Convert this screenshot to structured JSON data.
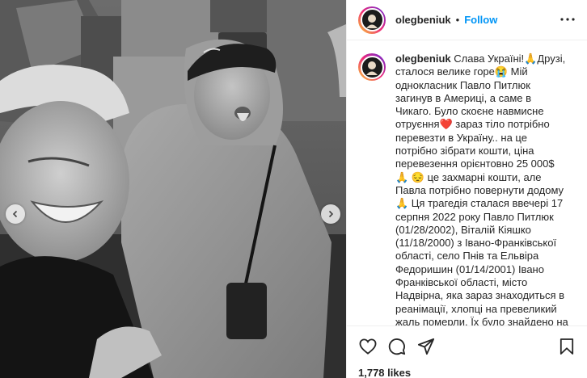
{
  "post": {
    "username": "olegbeniuk",
    "follow_label": "Follow",
    "separator": "•",
    "caption": "Слава Україні!🙏Друзі, сталося велике горе😭 Мій однокласник Павло Питлюк загинув в Америці, а саме в Чикаго. Було скоєне навмисне отруєння❤️ зараз тіло потрібно перевезти в Україну.. на це потрібно зібрати кошти, ціна перевезення орієнтовно 25 000$ 🙏 😔 це захмарні кошти, але Павла потрібно повернути додому🙏 Ця трагедія сталася ввечері 17 серпня 2022 року Павло Питлюк (01/28/2002), Віталій Кіяшко (11/18/2000) з Івано-Франківської області, село Пнів та Ельвіра Федоришин (01/14/2001) Івано Франківської області, місто Надвірна, яка зараз знаходиться в реанімації, хлопці на превеликий жаль померли. Їх було знайдено на вулиці в",
    "likes": "1,778 likes"
  },
  "icons": {
    "header_more": "more-horizontal-icon",
    "like": "heart-icon",
    "comment": "comment-icon",
    "share": "share-icon",
    "save": "bookmark-icon",
    "prev": "chevron-left-icon",
    "next": "chevron-right-icon"
  },
  "colors": {
    "follow_blue": "#0095f6",
    "text": "#262626",
    "divider": "#efefef"
  }
}
